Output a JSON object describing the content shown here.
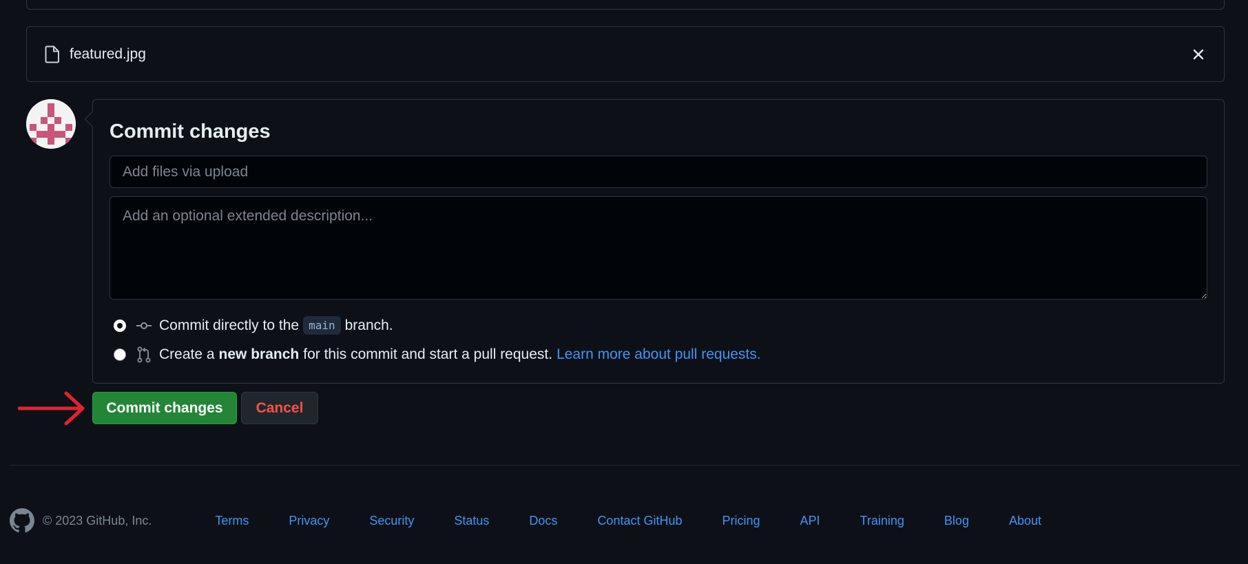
{
  "file": {
    "name": "featured.jpg",
    "file_icon": "file-icon",
    "remove_icon": "x-icon"
  },
  "commit_form": {
    "title": "Commit changes",
    "summary_placeholder": "Add files via upload",
    "description_placeholder": "Add an optional extended description...",
    "options": [
      {
        "selected": true,
        "icon": "git-commit-icon",
        "text_before": "Commit directly to the",
        "branch_code": "main",
        "text_after": "branch."
      },
      {
        "selected": false,
        "icon": "git-pull-request-icon",
        "text_before": "Create a",
        "bold_text": "new branch",
        "text_after": "for this commit and start a pull request.",
        "link_text": "Learn more about pull requests."
      }
    ]
  },
  "buttons": {
    "commit_label": "Commit changes",
    "cancel_label": "Cancel"
  },
  "annotation": {
    "arrow_color": "#e0242f"
  },
  "footer": {
    "logo": "github-mark-icon",
    "copyright": "© 2023 GitHub, Inc.",
    "links": [
      "Terms",
      "Privacy",
      "Security",
      "Status",
      "Docs",
      "Contact GitHub",
      "Pricing",
      "API",
      "Training",
      "Blog",
      "About"
    ]
  },
  "colors": {
    "background": "#0d1117",
    "border": "#30363d",
    "primary_button": "#238636",
    "danger_text": "#f85149",
    "link": "#4493f8",
    "avatar_pink": "#c8557a"
  }
}
